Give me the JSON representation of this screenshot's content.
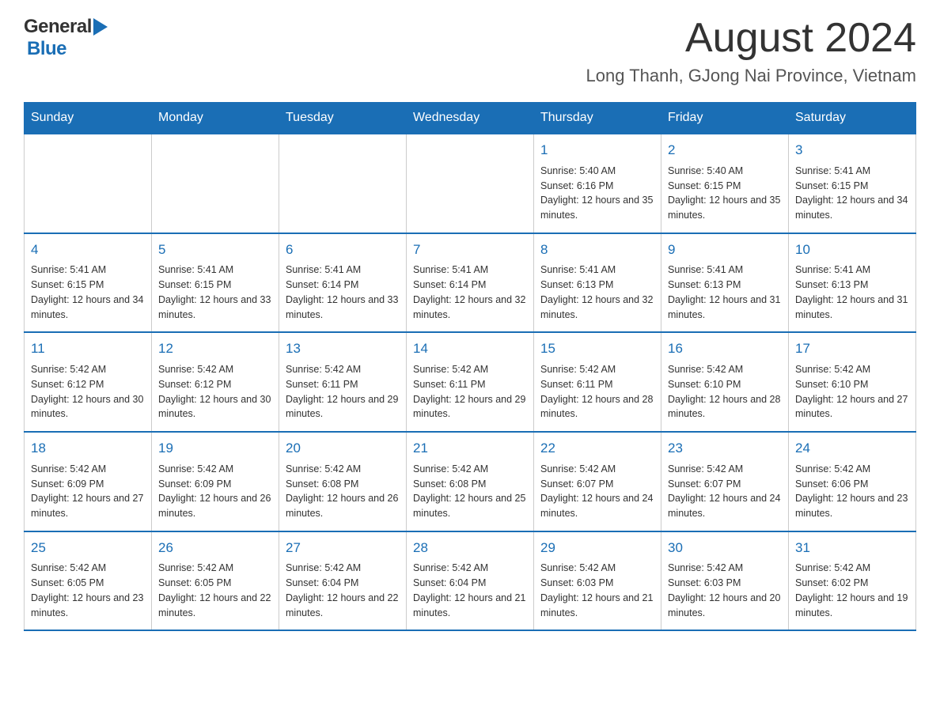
{
  "header": {
    "logo_general": "General",
    "logo_triangle": "▶",
    "logo_blue": "Blue",
    "month_title": "August 2024",
    "location": "Long Thanh, GJong Nai Province, Vietnam"
  },
  "days_of_week": [
    "Sunday",
    "Monday",
    "Tuesday",
    "Wednesday",
    "Thursday",
    "Friday",
    "Saturday"
  ],
  "weeks": [
    {
      "days": [
        {
          "number": "",
          "info": ""
        },
        {
          "number": "",
          "info": ""
        },
        {
          "number": "",
          "info": ""
        },
        {
          "number": "",
          "info": ""
        },
        {
          "number": "1",
          "info": "Sunrise: 5:40 AM\nSunset: 6:16 PM\nDaylight: 12 hours and 35 minutes."
        },
        {
          "number": "2",
          "info": "Sunrise: 5:40 AM\nSunset: 6:15 PM\nDaylight: 12 hours and 35 minutes."
        },
        {
          "number": "3",
          "info": "Sunrise: 5:41 AM\nSunset: 6:15 PM\nDaylight: 12 hours and 34 minutes."
        }
      ]
    },
    {
      "days": [
        {
          "number": "4",
          "info": "Sunrise: 5:41 AM\nSunset: 6:15 PM\nDaylight: 12 hours and 34 minutes."
        },
        {
          "number": "5",
          "info": "Sunrise: 5:41 AM\nSunset: 6:15 PM\nDaylight: 12 hours and 33 minutes."
        },
        {
          "number": "6",
          "info": "Sunrise: 5:41 AM\nSunset: 6:14 PM\nDaylight: 12 hours and 33 minutes."
        },
        {
          "number": "7",
          "info": "Sunrise: 5:41 AM\nSunset: 6:14 PM\nDaylight: 12 hours and 32 minutes."
        },
        {
          "number": "8",
          "info": "Sunrise: 5:41 AM\nSunset: 6:13 PM\nDaylight: 12 hours and 32 minutes."
        },
        {
          "number": "9",
          "info": "Sunrise: 5:41 AM\nSunset: 6:13 PM\nDaylight: 12 hours and 31 minutes."
        },
        {
          "number": "10",
          "info": "Sunrise: 5:41 AM\nSunset: 6:13 PM\nDaylight: 12 hours and 31 minutes."
        }
      ]
    },
    {
      "days": [
        {
          "number": "11",
          "info": "Sunrise: 5:42 AM\nSunset: 6:12 PM\nDaylight: 12 hours and 30 minutes."
        },
        {
          "number": "12",
          "info": "Sunrise: 5:42 AM\nSunset: 6:12 PM\nDaylight: 12 hours and 30 minutes."
        },
        {
          "number": "13",
          "info": "Sunrise: 5:42 AM\nSunset: 6:11 PM\nDaylight: 12 hours and 29 minutes."
        },
        {
          "number": "14",
          "info": "Sunrise: 5:42 AM\nSunset: 6:11 PM\nDaylight: 12 hours and 29 minutes."
        },
        {
          "number": "15",
          "info": "Sunrise: 5:42 AM\nSunset: 6:11 PM\nDaylight: 12 hours and 28 minutes."
        },
        {
          "number": "16",
          "info": "Sunrise: 5:42 AM\nSunset: 6:10 PM\nDaylight: 12 hours and 28 minutes."
        },
        {
          "number": "17",
          "info": "Sunrise: 5:42 AM\nSunset: 6:10 PM\nDaylight: 12 hours and 27 minutes."
        }
      ]
    },
    {
      "days": [
        {
          "number": "18",
          "info": "Sunrise: 5:42 AM\nSunset: 6:09 PM\nDaylight: 12 hours and 27 minutes."
        },
        {
          "number": "19",
          "info": "Sunrise: 5:42 AM\nSunset: 6:09 PM\nDaylight: 12 hours and 26 minutes."
        },
        {
          "number": "20",
          "info": "Sunrise: 5:42 AM\nSunset: 6:08 PM\nDaylight: 12 hours and 26 minutes."
        },
        {
          "number": "21",
          "info": "Sunrise: 5:42 AM\nSunset: 6:08 PM\nDaylight: 12 hours and 25 minutes."
        },
        {
          "number": "22",
          "info": "Sunrise: 5:42 AM\nSunset: 6:07 PM\nDaylight: 12 hours and 24 minutes."
        },
        {
          "number": "23",
          "info": "Sunrise: 5:42 AM\nSunset: 6:07 PM\nDaylight: 12 hours and 24 minutes."
        },
        {
          "number": "24",
          "info": "Sunrise: 5:42 AM\nSunset: 6:06 PM\nDaylight: 12 hours and 23 minutes."
        }
      ]
    },
    {
      "days": [
        {
          "number": "25",
          "info": "Sunrise: 5:42 AM\nSunset: 6:05 PM\nDaylight: 12 hours and 23 minutes."
        },
        {
          "number": "26",
          "info": "Sunrise: 5:42 AM\nSunset: 6:05 PM\nDaylight: 12 hours and 22 minutes."
        },
        {
          "number": "27",
          "info": "Sunrise: 5:42 AM\nSunset: 6:04 PM\nDaylight: 12 hours and 22 minutes."
        },
        {
          "number": "28",
          "info": "Sunrise: 5:42 AM\nSunset: 6:04 PM\nDaylight: 12 hours and 21 minutes."
        },
        {
          "number": "29",
          "info": "Sunrise: 5:42 AM\nSunset: 6:03 PM\nDaylight: 12 hours and 21 minutes."
        },
        {
          "number": "30",
          "info": "Sunrise: 5:42 AM\nSunset: 6:03 PM\nDaylight: 12 hours and 20 minutes."
        },
        {
          "number": "31",
          "info": "Sunrise: 5:42 AM\nSunset: 6:02 PM\nDaylight: 12 hours and 19 minutes."
        }
      ]
    }
  ]
}
